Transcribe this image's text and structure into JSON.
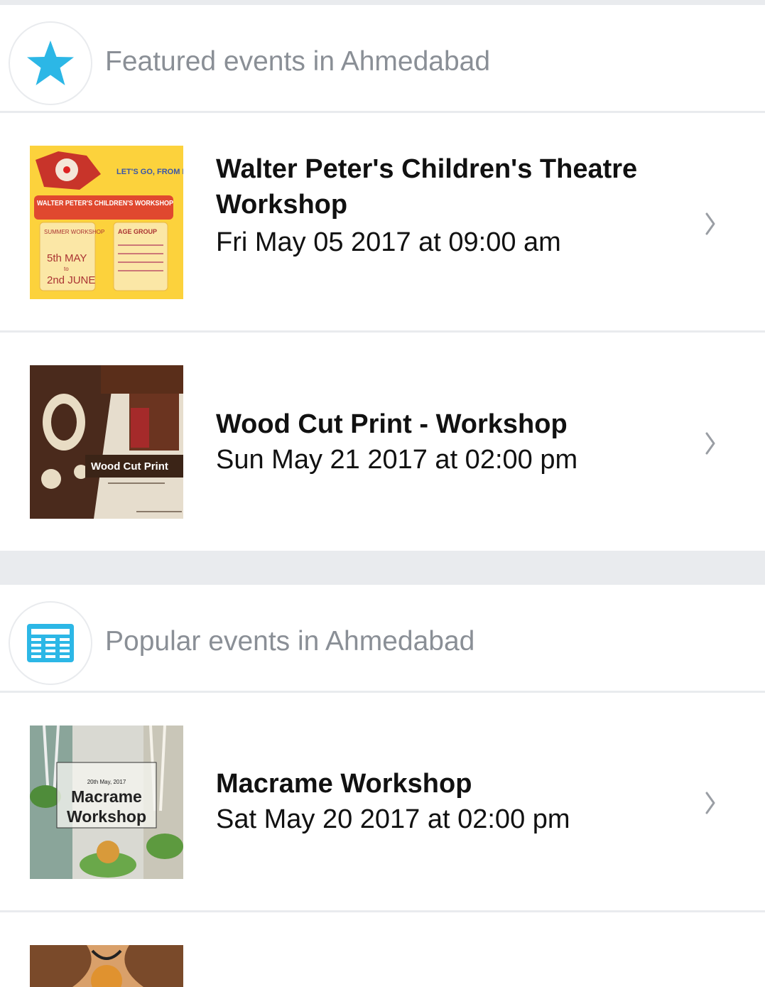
{
  "featured": {
    "title": "Featured events in Ahmedabad",
    "icon": "star-icon",
    "accent": "#2cb7e6",
    "events": [
      {
        "name_line1": "Walter Peter's Children's Theatre",
        "name_line2": "Workshop",
        "datetime": "Fri May 05 2017 at 09:00 am",
        "thumb": {
          "top_right": "LET'S GO, FROM ME TO WE",
          "banner": "WALTER PETER'S CHILDREN'S WORKSHOP",
          "left_box_1": "SUMMER WORKSHOP",
          "left_box_2": "5th MAY",
          "left_box_3": "to",
          "left_box_4": "2nd JUNE",
          "right_box": "AGE GROUP"
        }
      },
      {
        "name": "Wood Cut Print - Workshop",
        "datetime": "Sun May 21 2017 at 02:00 pm",
        "thumb": {
          "label": "Wood Cut Print"
        }
      }
    ]
  },
  "popular": {
    "title": "Popular events in Ahmedabad",
    "icon": "newspaper-icon",
    "events": [
      {
        "name": "Macrame Workshop",
        "datetime": "Sat May 20 2017 at 02:00 pm",
        "thumb": {
          "small": "20th May, 2017",
          "line1": "Macrame",
          "line2": "Workshop"
        }
      }
    ]
  }
}
